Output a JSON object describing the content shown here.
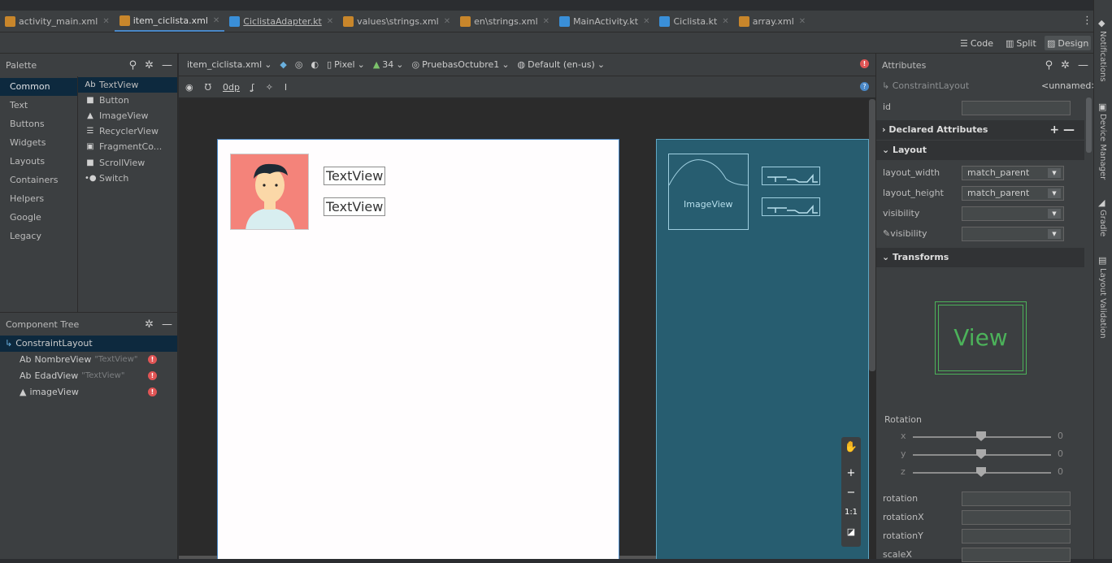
{
  "tabs": [
    {
      "label": "activity_main.xml",
      "kind": "xml"
    },
    {
      "label": "item_ciclista.xml",
      "kind": "xml",
      "active": true
    },
    {
      "label": "CiclistaAdapter.kt",
      "kind": "kt"
    },
    {
      "label": "values\\strings.xml",
      "kind": "xml"
    },
    {
      "label": "en\\strings.xml",
      "kind": "xml"
    },
    {
      "label": "MainActivity.kt",
      "kind": "kt"
    },
    {
      "label": "Ciclista.kt",
      "kind": "kt"
    },
    {
      "label": "array.xml",
      "kind": "xml"
    }
  ],
  "mode": {
    "code": "Code",
    "split": "Split",
    "design": "Design"
  },
  "palette": {
    "title": "Palette",
    "categories": [
      "Common",
      "Text",
      "Buttons",
      "Widgets",
      "Layouts",
      "Containers",
      "Helpers",
      "Google",
      "Legacy"
    ],
    "items": [
      {
        "icon": "Ab",
        "label": "TextView"
      },
      {
        "icon": "■",
        "label": "Button"
      },
      {
        "icon": "▲",
        "label": "ImageView"
      },
      {
        "icon": "☰",
        "label": "RecyclerView"
      },
      {
        "icon": "▣",
        "label": "FragmentCo..."
      },
      {
        "icon": "■",
        "label": "ScrollView"
      },
      {
        "icon": "•●",
        "label": "Switch"
      }
    ]
  },
  "component_tree": {
    "title": "Component Tree",
    "root": "ConstraintLayout",
    "children": [
      {
        "icon": "Ab",
        "label": "NombreView",
        "hint": "\"TextView\""
      },
      {
        "icon": "Ab",
        "label": "EdadView",
        "hint": "\"TextView\""
      },
      {
        "icon": "▲",
        "label": "imageView",
        "hint": ""
      }
    ]
  },
  "design_toolbar": {
    "file": "item_ciclista.xml",
    "device": "Pixel",
    "api": "34",
    "theme": "PruebasOctubre1",
    "locale": "Default (en-us)",
    "margin": "0dp"
  },
  "preview": {
    "textview1": "TextView",
    "textview2": "TextView",
    "blueprint_image_label": "ImageView"
  },
  "zoom": {
    "one_to_one": "1:1",
    "plus": "+",
    "minus": "−"
  },
  "attributes": {
    "title": "Attributes",
    "component": "ConstraintLayout",
    "name": "<unnamed>",
    "id_label": "id",
    "declared": "Declared Attributes",
    "layout_section": "Layout",
    "layout_width_label": "layout_width",
    "layout_width_value": "match_parent",
    "layout_height_label": "layout_height",
    "layout_height_value": "match_parent",
    "visibility_label": "visibility",
    "visibility_tools_label": "visibility",
    "transforms_section": "Transforms",
    "view_preview": "View",
    "rotation_title": "Rotation",
    "rot_x": "x",
    "rot_y": "y",
    "rot_z": "z",
    "rot_x_value": "0",
    "rot_y_value": "0",
    "rot_z_value": "0",
    "rotation_label": "rotation",
    "rotationX_label": "rotationX",
    "rotationY_label": "rotationY",
    "scaleX_label": "scaleX"
  },
  "side_tools": [
    "Notifications",
    "Device Manager",
    "Gradle",
    "Layout Validation"
  ]
}
